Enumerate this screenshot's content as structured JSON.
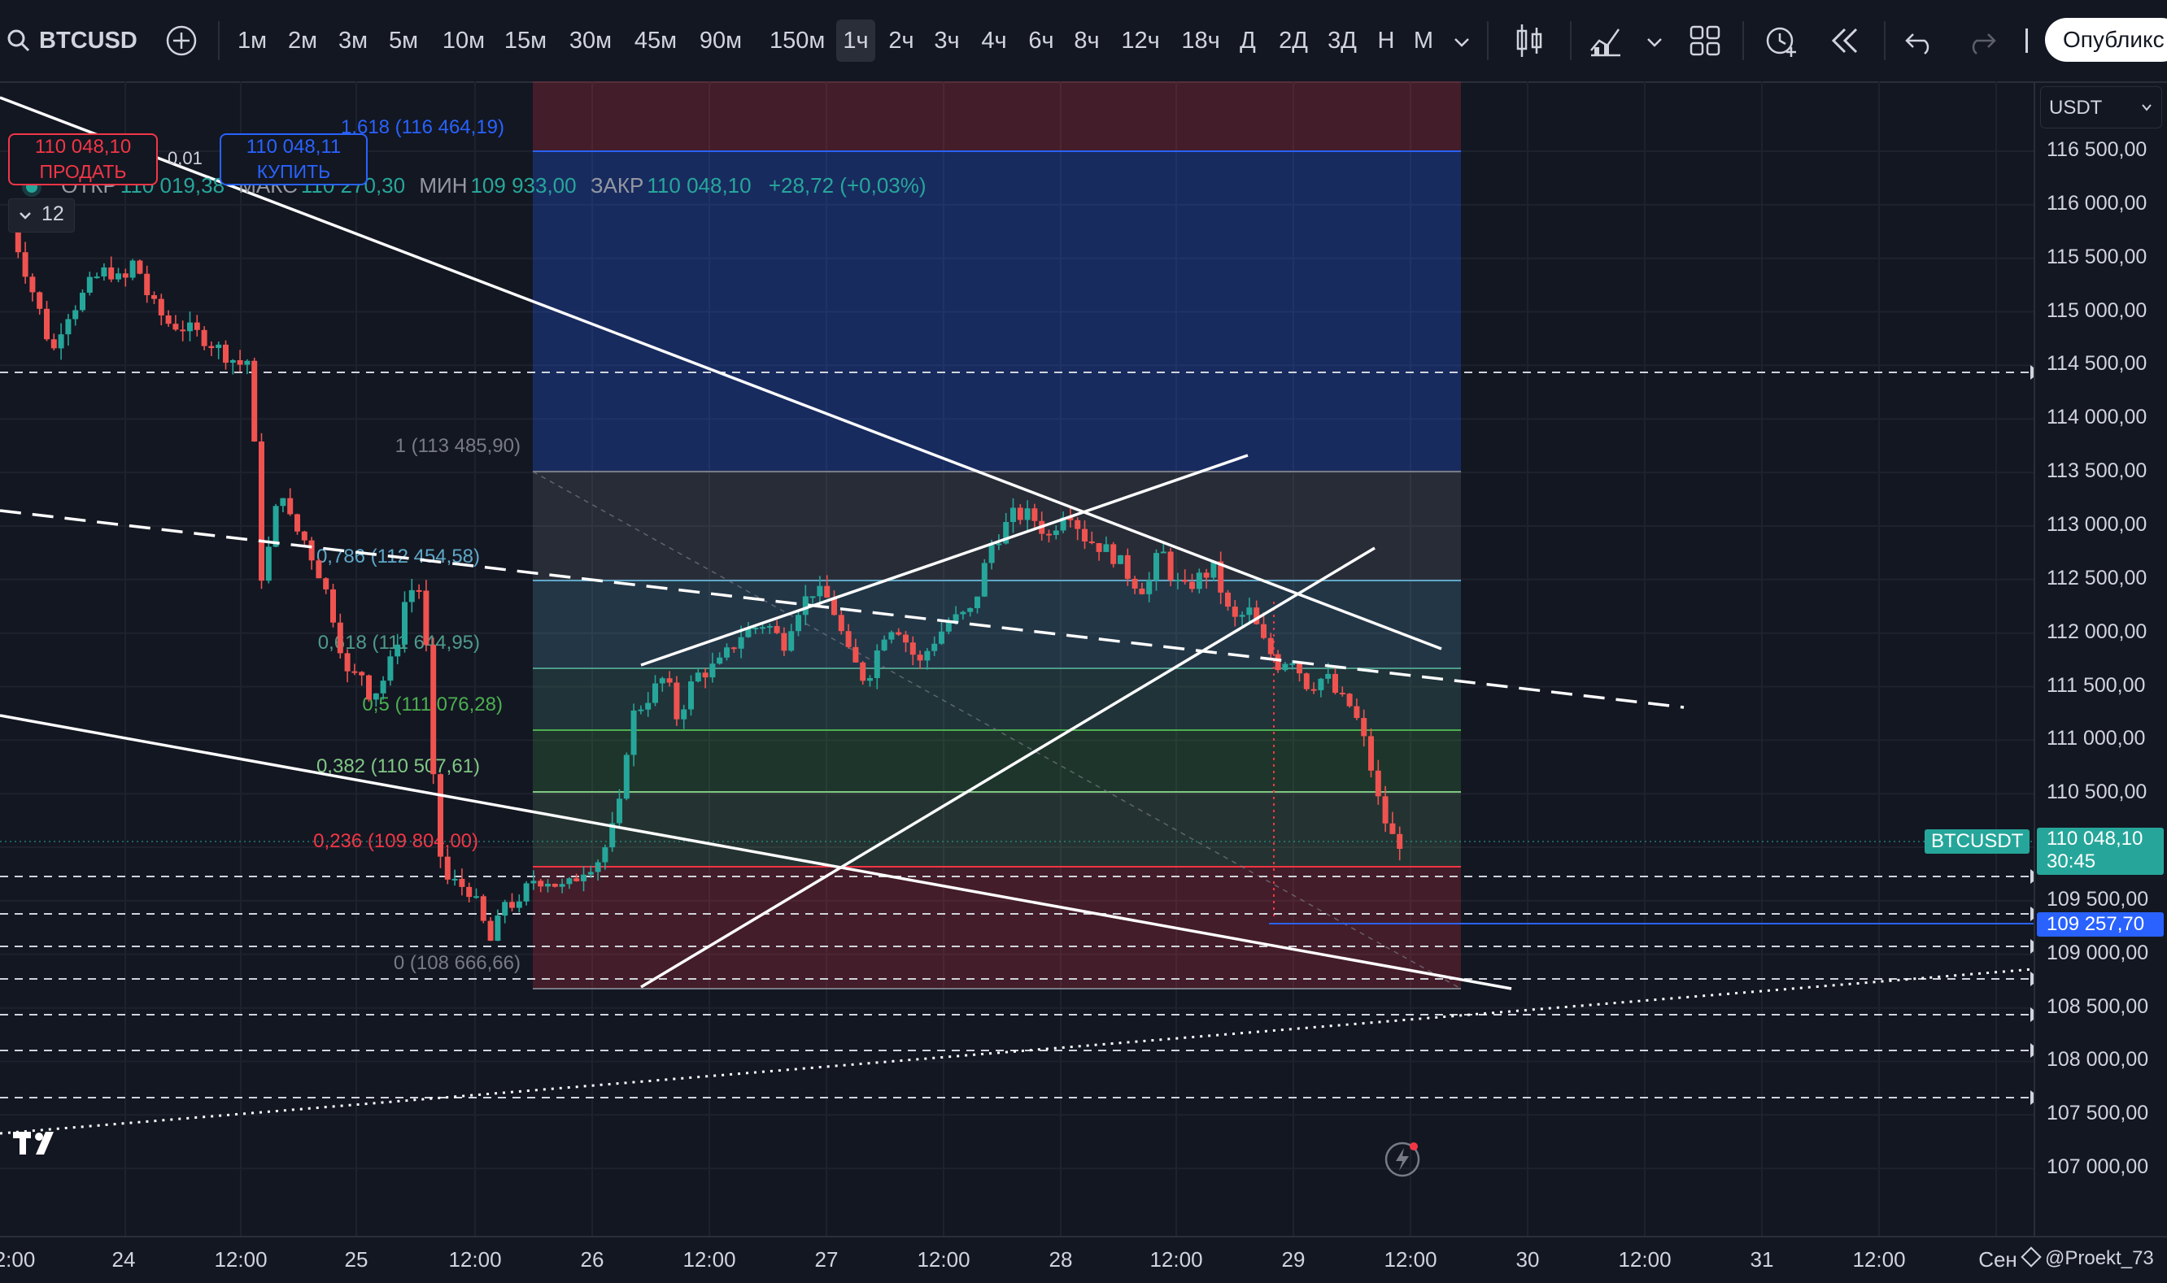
{
  "toolbar": {
    "symbol": "BTCUSD",
    "intervals": [
      "1м",
      "2м",
      "3м",
      "5м",
      "10м",
      "15м",
      "30м",
      "45м",
      "90м",
      "150м",
      "1ч",
      "2ч",
      "3ч",
      "4ч",
      "6ч",
      "8ч",
      "12ч",
      "18ч",
      "Д",
      "2Д",
      "3Д",
      "Н",
      "М"
    ],
    "active_interval": "1ч",
    "publish_label": "Опубликс"
  },
  "legend": {
    "open_label": "ОТКР",
    "open": "110 019,38",
    "high_label": "МАКС",
    "high": "110 270,30",
    "low_label": "МИН",
    "low": "109 933,00",
    "close_label": "ЗАКР",
    "close": "110 048,10",
    "change": "+28,72 (+0,03%)"
  },
  "trade": {
    "sell_price": "110 048,10",
    "sell_label": "ПРОДАТЬ",
    "spread": "0,01",
    "buy_price": "110 048,11",
    "buy_label": "КУПИТЬ"
  },
  "indicator_count": "12",
  "currency": "USDT",
  "fib": {
    "levels": [
      {
        "label": "1,618 (116 464,19)",
        "color": "#2962ff"
      },
      {
        "label": "1 (113 485,90)",
        "color": "#787b86"
      },
      {
        "label": "0,786 (112 454,58)",
        "color": "#5fa8c7"
      },
      {
        "label": "0,618 (111 644,95)",
        "color": "#4e9a8a"
      },
      {
        "label": "0,5 (111 076,28)",
        "color": "#4caf50"
      },
      {
        "label": "0,382 (110 507,61)",
        "color": "#81c784"
      },
      {
        "label": "0,236 (109 804,00)",
        "color": "#f23645"
      },
      {
        "label": "0 (108 666,66)",
        "color": "#787b86"
      }
    ]
  },
  "price_axis": {
    "labels": [
      "116 500,00",
      "116 000,00",
      "115 500,00",
      "115 000,00",
      "114 500,00",
      "114 000,00",
      "113 500,00",
      "113 000,00",
      "112 500,00",
      "112 000,00",
      "111 500,00",
      "111 000,00",
      "110 500,00",
      "110 000,00",
      "109 500,00",
      "109 000,00",
      "108 500,00",
      "108 000,00",
      "107 500,00",
      "107 000,00"
    ],
    "current_symbol": "BTCUSDT",
    "current_price": "110 048,10",
    "countdown": "30:45",
    "alert_price": "109 257,70"
  },
  "time_axis": {
    "labels": [
      "2:00",
      "24",
      "12:00",
      "25",
      "12:00",
      "26",
      "12:00",
      "27",
      "12:00",
      "28",
      "12:00",
      "29",
      "12:00",
      "30",
      "12:00",
      "31",
      "12:00",
      "Сен"
    ],
    "watermark": "@Proekt_73"
  },
  "colors": {
    "bg": "#131722",
    "up": "#26a69a",
    "down": "#ef5350",
    "accent": "#2962ff"
  },
  "icons": [
    "search-icon",
    "plus-circle-icon",
    "chevron-down-icon",
    "candles-icon",
    "indicators-icon",
    "layout-icon",
    "alert-icon",
    "replay-icon",
    "undo-icon",
    "redo-icon",
    "flash-icon",
    "tradingview-logo"
  ]
}
